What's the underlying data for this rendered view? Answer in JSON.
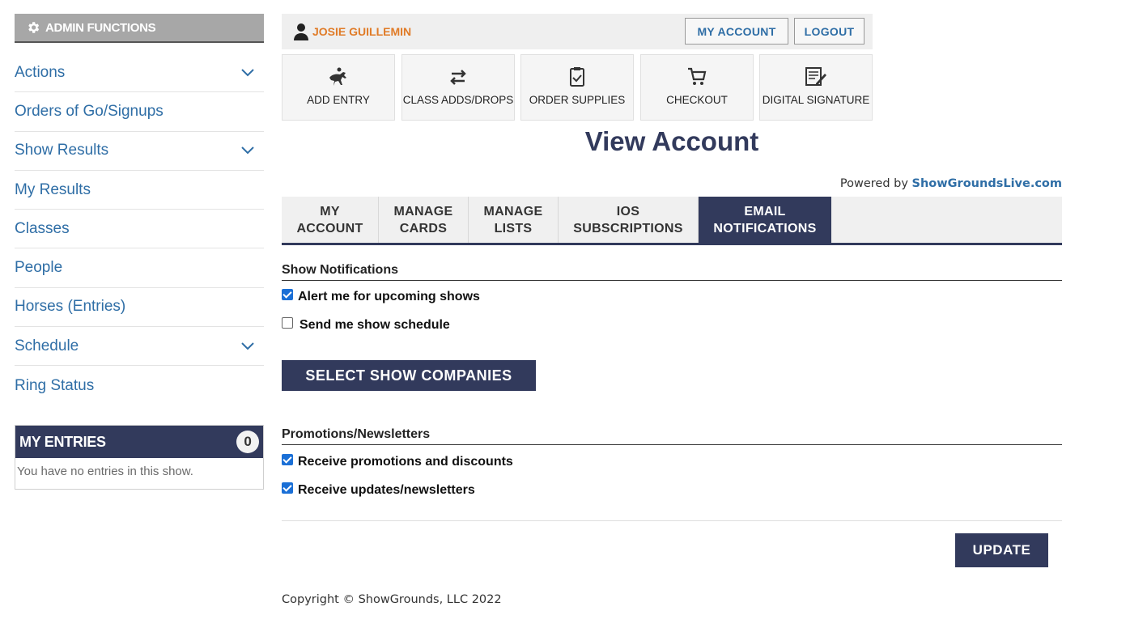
{
  "sidebar": {
    "admin_title": "ADMIN FUNCTIONS",
    "items": [
      {
        "label": "Actions",
        "expandable": true
      },
      {
        "label": "Orders of Go/Signups",
        "expandable": false
      },
      {
        "label": "Show Results",
        "expandable": true
      },
      {
        "label": "My Results",
        "expandable": false
      },
      {
        "label": "Classes",
        "expandable": false
      },
      {
        "label": "People",
        "expandable": false
      },
      {
        "label": "Horses (Entries)",
        "expandable": false
      },
      {
        "label": "Schedule",
        "expandable": true
      },
      {
        "label": "Ring Status",
        "expandable": false
      }
    ],
    "my_entries": {
      "title": "MY ENTRIES",
      "count": "0",
      "empty_text": "You have no entries in this show."
    }
  },
  "userbar": {
    "user_name": "JOSIE GUILLEMIN",
    "my_account": "MY ACCOUNT",
    "logout": "LOGOUT"
  },
  "tiles": [
    {
      "label": "ADD ENTRY",
      "icon": "horse-rider-icon"
    },
    {
      "label": "CLASS ADDS/DROPS",
      "icon": "swap-arrows-icon"
    },
    {
      "label": "ORDER SUPPLIES",
      "icon": "clipboard-check-icon"
    },
    {
      "label": "CHECKOUT",
      "icon": "shopping-cart-icon"
    },
    {
      "label": "DIGITAL SIGNATURE",
      "icon": "signature-document-icon"
    }
  ],
  "page": {
    "title": "View Account",
    "powered_prefix": "Powered by",
    "powered_brand": "ShowGroundsLive.com"
  },
  "tabs": [
    {
      "line1": "MY",
      "line2": "ACCOUNT",
      "active": false
    },
    {
      "line1": "MANAGE",
      "line2": "CARDS",
      "active": false
    },
    {
      "line1": "MANAGE",
      "line2": "LISTS",
      "active": false
    },
    {
      "line1": "IOS",
      "line2": "SUBSCRIPTIONS",
      "active": false
    },
    {
      "line1": "EMAIL",
      "line2": "NOTIFICATIONS",
      "active": true
    }
  ],
  "show_notifications": {
    "title": "Show Notifications",
    "alert_upcoming": {
      "label": "Alert me for upcoming shows",
      "checked": true
    },
    "send_schedule": {
      "label": "Send me show schedule",
      "checked": false
    },
    "select_companies": "SELECT SHOW COMPANIES"
  },
  "promotions": {
    "title": "Promotions/Newsletters",
    "promotions_discounts": {
      "label": "Receive promotions and discounts",
      "checked": true
    },
    "updates_newsletters": {
      "label": "Receive updates/newsletters",
      "checked": true
    }
  },
  "update_button": "UPDATE",
  "footer": {
    "copyright": "Copyright © ShowGrounds, LLC 2022"
  },
  "colors": {
    "navy": "#323a5c",
    "link_blue": "#2f6ea6",
    "user_orange": "#e07b27",
    "checkbox_blue": "#1a6fd6"
  }
}
